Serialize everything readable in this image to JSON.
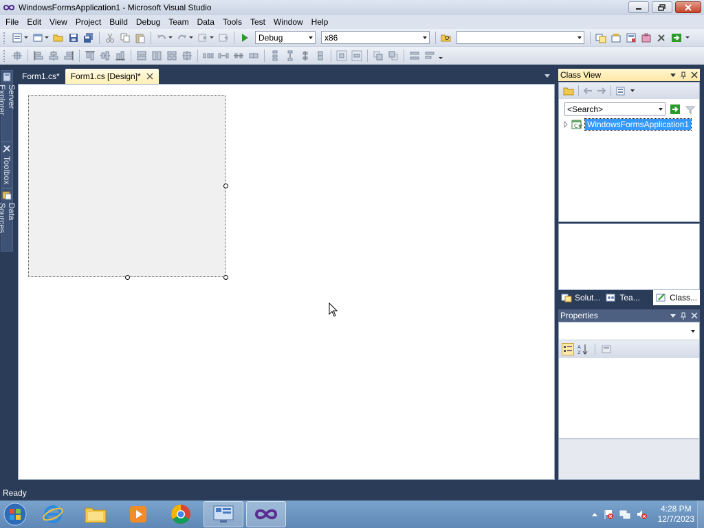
{
  "window": {
    "title": "WindowsFormsApplication1 - Microsoft Visual Studio"
  },
  "menu": [
    "File",
    "Edit",
    "View",
    "Project",
    "Build",
    "Debug",
    "Team",
    "Data",
    "Tools",
    "Test",
    "Window",
    "Help"
  ],
  "toolbar": {
    "configuration": "Debug",
    "platform": "x86",
    "find_value": ""
  },
  "left_rail": {
    "tabs": [
      "Server Explorer",
      "Toolbox",
      "Data Sources"
    ]
  },
  "document_tabs": [
    {
      "label": "Form1.cs*",
      "active": false
    },
    {
      "label": "Form1.cs [Design]*",
      "active": true
    }
  ],
  "class_view": {
    "title": "Class View",
    "search_placeholder": "<Search>",
    "tree_root": "WindowsFormsApplication1"
  },
  "bottom_tabs": [
    "Solut...",
    "Tea...",
    "Class..."
  ],
  "properties": {
    "title": "Properties"
  },
  "status": {
    "text": "Ready"
  },
  "taskbar": {
    "time": "4:28 PM",
    "date": "12/7/2023"
  },
  "colors": {
    "ide_background": "#2b3c59",
    "active_tab": "#fff0b5",
    "selection": "#3399ff"
  }
}
